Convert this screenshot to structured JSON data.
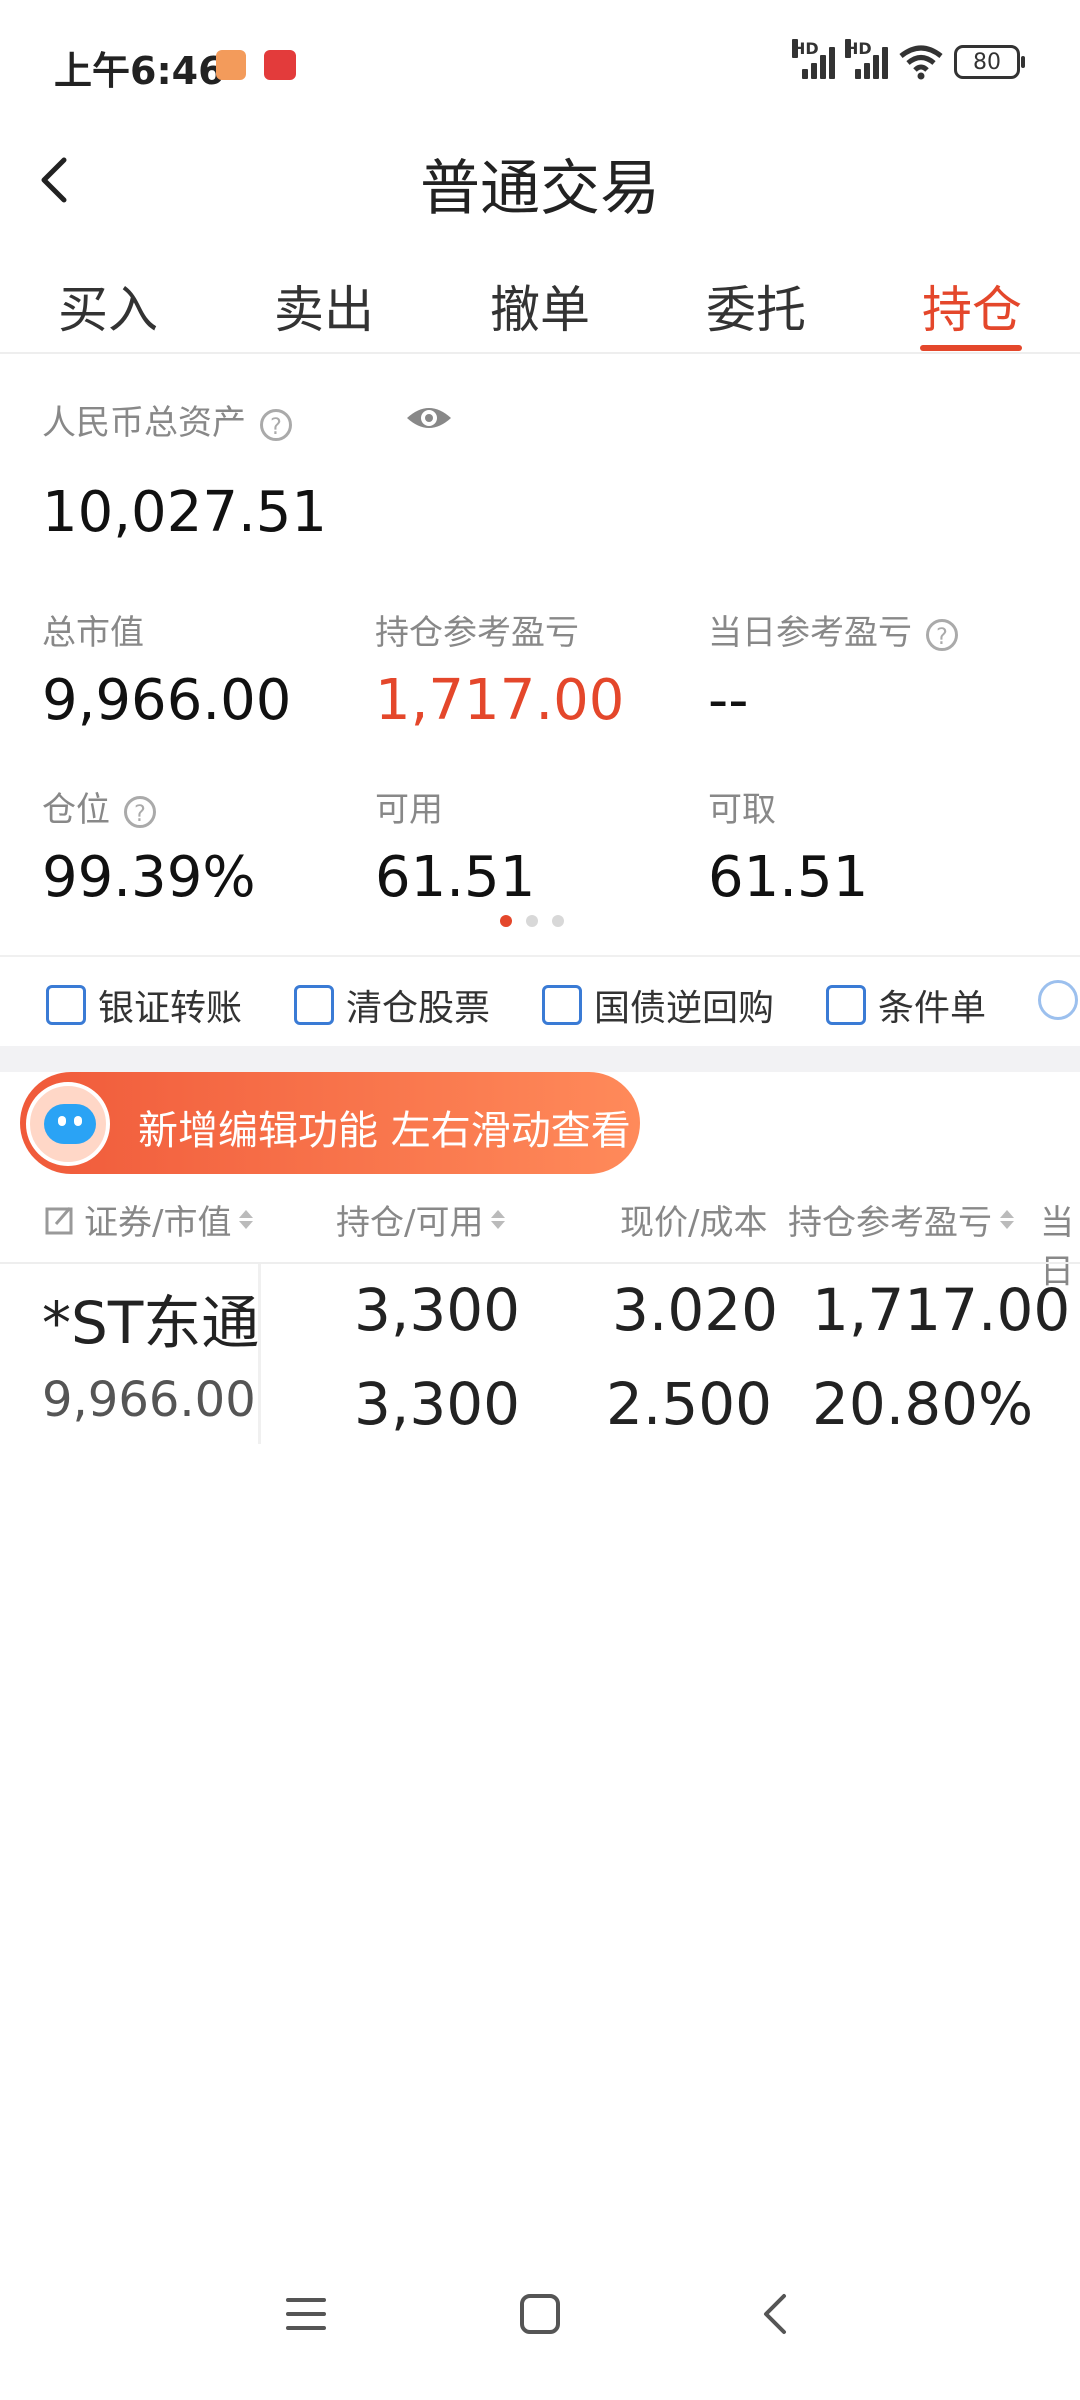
{
  "status_bar": {
    "time": "上午6:46",
    "network_1": "HD",
    "network_2": "HD",
    "battery": "80"
  },
  "header": {
    "title": "普通交易",
    "back_icon": "chevron-left-icon"
  },
  "tabs": [
    {
      "label": "买入",
      "active": false
    },
    {
      "label": "卖出",
      "active": false
    },
    {
      "label": "撤单",
      "active": false
    },
    {
      "label": "委托",
      "active": false
    },
    {
      "label": "持仓",
      "active": true
    }
  ],
  "assets": {
    "total_label": "人民币总资产",
    "total_value": "10,027.51",
    "market_value_label": "总市值",
    "market_value": "9,966.00",
    "position_pl_label": "持仓参考盈亏",
    "position_pl": "1,717.00",
    "daily_pl_label": "当日参考盈亏",
    "daily_pl": "--",
    "position_ratio_label": "仓位",
    "position_ratio": "99.39%",
    "available_label": "可用",
    "available": "61.51",
    "withdrawable_label": "可取",
    "withdrawable": "61.51"
  },
  "quick_actions": [
    {
      "label": "银证转账",
      "icon": "transfer-icon"
    },
    {
      "label": "清仓股票",
      "icon": "chart-icon"
    },
    {
      "label": "国债逆回购",
      "icon": "repo-icon"
    },
    {
      "label": "条件单",
      "icon": "condition-icon"
    }
  ],
  "banner": {
    "text": "新增编辑功能 左右滑动查看"
  },
  "table": {
    "headers": [
      "证券/市值",
      "持仓/可用",
      "现价/成本",
      "持仓参考盈亏",
      "当日"
    ],
    "rows": [
      {
        "name": "*ST东通",
        "market_value": "9,966.00",
        "position": "3,300",
        "available": "3,300",
        "price": "3.020",
        "cost": "2.500",
        "pl": "1,717.00",
        "pl_pct": "20.80%"
      }
    ]
  },
  "colors": {
    "accent": "#e4472b",
    "action_blue": "#3a7bd5"
  }
}
